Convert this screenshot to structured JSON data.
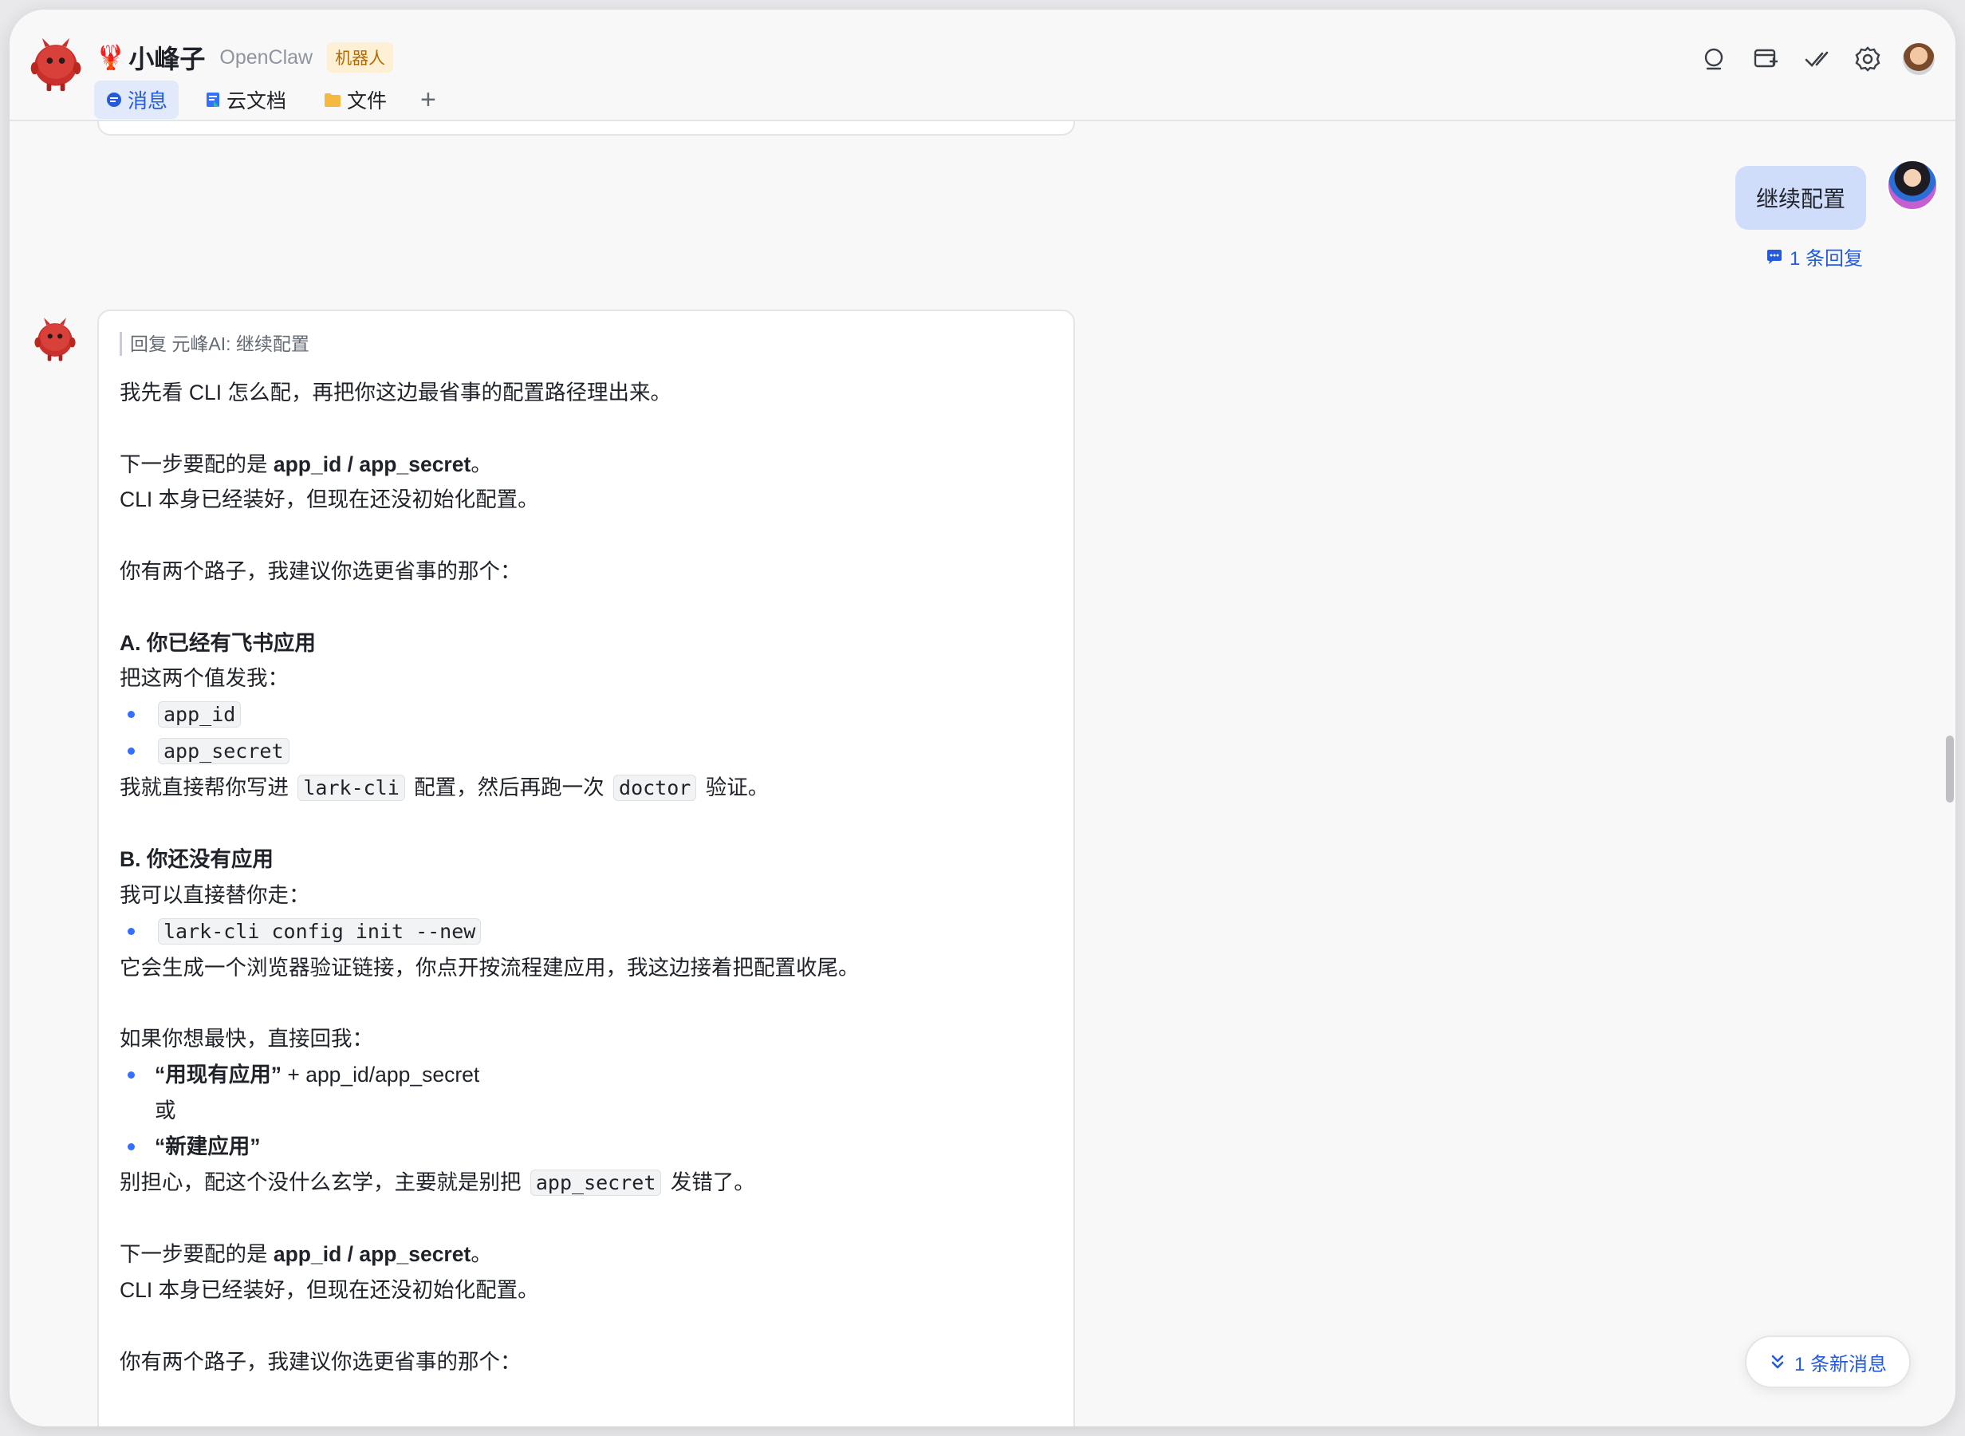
{
  "header": {
    "bot_name": "小峰子",
    "app_name": "OpenClaw",
    "badge": "机器人",
    "tabs": [
      {
        "label": "消息",
        "icon": "chat-bubble-icon",
        "active": true
      },
      {
        "label": "云文档",
        "icon": "doc-icon",
        "active": false
      },
      {
        "label": "文件",
        "icon": "folder-icon",
        "active": false
      }
    ],
    "add_tab": "+",
    "icons": [
      "search-icon",
      "add-screen-icon",
      "check-icon",
      "gear-icon",
      "avatar"
    ]
  },
  "user_message": {
    "text": "继续配置",
    "reply_count": "1 条回复"
  },
  "bot_message": {
    "quote": "回复 元峰AI:  继续配置",
    "intro": "我先看 CLI 怎么配，再把你这边最省事的配置路径理出来。",
    "p1_prefix": "下一步要配的是 ",
    "p1_bold": "app_id / app_secret",
    "p1_suffix": "。",
    "p2": "CLI 本身已经装好，但现在还没初始化配置。",
    "p3": "你有两个路子，我建议你选更省事的那个：",
    "a_title": "A. 你已经有飞书应用",
    "a_desc": "把这两个值发我：",
    "a_item1": "app_id",
    "a_item2": "app_secret",
    "a_line_1": "我就直接帮你写进 ",
    "a_code_1": "lark-cli",
    "a_line_2": " 配置，然后再跑一次 ",
    "a_code_2": "doctor",
    "a_line_3": " 验证。",
    "b_title": "B. 你还没有应用",
    "b_desc": "我可以直接替你走：",
    "b_item1": "lark-cli config init --new",
    "b_after": "它会生成一个浏览器验证链接，你点开按流程建应用，我这边接着把配置收尾。",
    "fast_intro": "如果你想最快，直接回我：",
    "fast_item1_bold": "“用现有应用”",
    "fast_item1_rest": " + app_id/app_secret",
    "fast_or": "或",
    "fast_item2_bold": "“新建应用”",
    "warn_1": "别担心，配这个没什么玄学，主要就是别把 ",
    "warn_code": "app_secret",
    "warn_2": " 发错了。",
    "r_p1_prefix": "下一步要配的是 ",
    "r_p1_bold": "app_id / app_secret",
    "r_p1_suffix": "。",
    "r_p2": "CLI 本身已经装好，但现在还没初始化配置。",
    "r_p3": "你有两个路子，我建议你选更省事的那个："
  },
  "new_messages": "1 条新消息",
  "colors": {
    "accent": "#245bdb",
    "bubble": "#cfdcfa",
    "bot_red": "#c9302c"
  }
}
